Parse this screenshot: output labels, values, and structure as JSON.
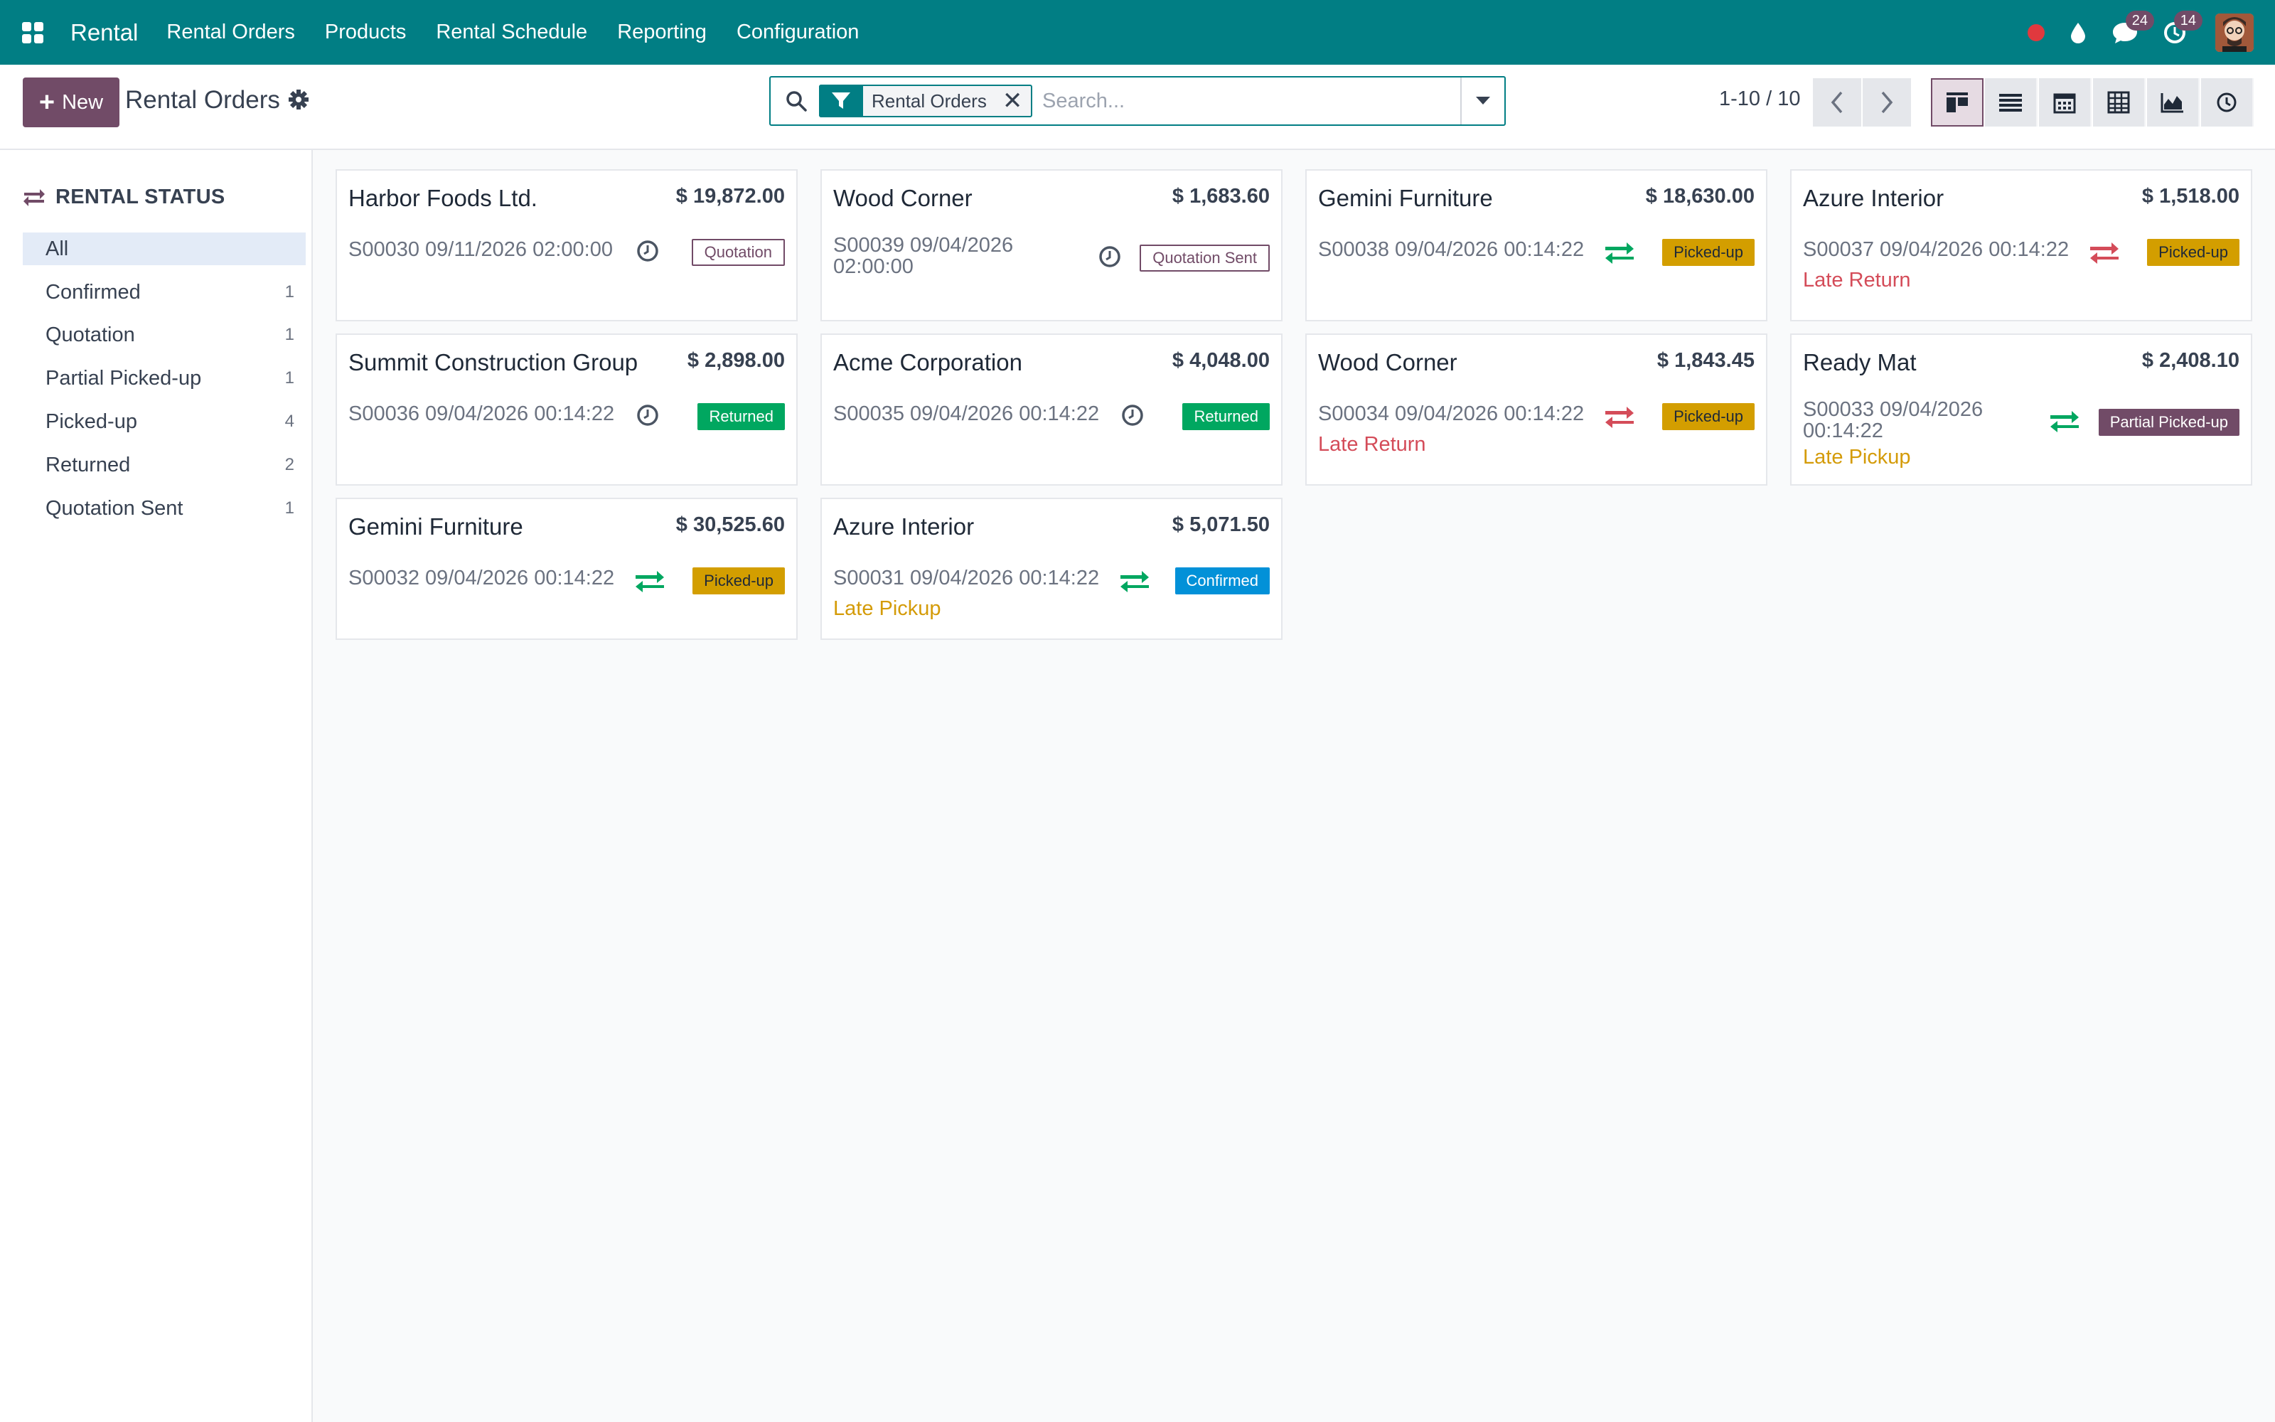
{
  "navbar": {
    "brand": "Rental",
    "menu": [
      "Rental Orders",
      "Products",
      "Rental Schedule",
      "Reporting",
      "Configuration"
    ],
    "messages_count": "24",
    "activities_count": "14"
  },
  "control": {
    "new_label": "New",
    "title": "Rental Orders",
    "facet_label": "Rental Orders",
    "search_placeholder": "Search...",
    "pager": "1-10 / 10"
  },
  "sidebar": {
    "header": "RENTAL STATUS",
    "items": [
      {
        "label": "All",
        "count": ""
      },
      {
        "label": "Confirmed",
        "count": "1"
      },
      {
        "label": "Quotation",
        "count": "1"
      },
      {
        "label": "Partial Picked-up",
        "count": "1"
      },
      {
        "label": "Picked-up",
        "count": "4"
      },
      {
        "label": "Returned",
        "count": "2"
      },
      {
        "label": "Quotation Sent",
        "count": "1"
      }
    ]
  },
  "cards": [
    {
      "customer": "Harbor Foods Ltd.",
      "amount": "$ 19,872.00",
      "ref": "S00030 09/11/2026 02:00:00",
      "status": "Quotation",
      "late": ""
    },
    {
      "customer": "Wood Corner",
      "amount": "$ 1,683.60",
      "ref": "S00039 09/04/2026 02:00:00",
      "status": "Quotation Sent",
      "late": ""
    },
    {
      "customer": "Gemini Furniture",
      "amount": "$ 18,630.00",
      "ref": "S00038 09/04/2026 00:14:22",
      "status": "Picked-up",
      "late": ""
    },
    {
      "customer": "Azure Interior",
      "amount": "$ 1,518.00",
      "ref": "S00037 09/04/2026 00:14:22",
      "status": "Picked-up",
      "late": "Late Return"
    },
    {
      "customer": "Summit Construction Group",
      "amount": "$ 2,898.00",
      "ref": "S00036 09/04/2026 00:14:22",
      "status": "Returned",
      "late": ""
    },
    {
      "customer": "Acme Corporation",
      "amount": "$ 4,048.00",
      "ref": "S00035 09/04/2026 00:14:22",
      "status": "Returned",
      "late": ""
    },
    {
      "customer": "Wood Corner",
      "amount": "$ 1,843.45",
      "ref": "S00034 09/04/2026 00:14:22",
      "status": "Picked-up",
      "late": "Late Return"
    },
    {
      "customer": "Ready Mat",
      "amount": "$ 2,408.10",
      "ref": "S00033 09/04/2026 00:14:22",
      "status": "Partial Picked-up",
      "late": "Late Pickup"
    },
    {
      "customer": "Gemini Furniture",
      "amount": "$ 30,525.60",
      "ref": "S00032 09/04/2026 00:14:22",
      "status": "Picked-up",
      "late": ""
    },
    {
      "customer": "Azure Interior",
      "amount": "$ 5,071.50",
      "ref": "S00031 09/04/2026 00:14:22",
      "status": "Confirmed",
      "late": "Late Pickup"
    }
  ],
  "colors": {
    "navbar": "#017e84",
    "brand_primary": "#714b67",
    "late_return": "#d44c59",
    "late_pickup": "#d49b08"
  }
}
